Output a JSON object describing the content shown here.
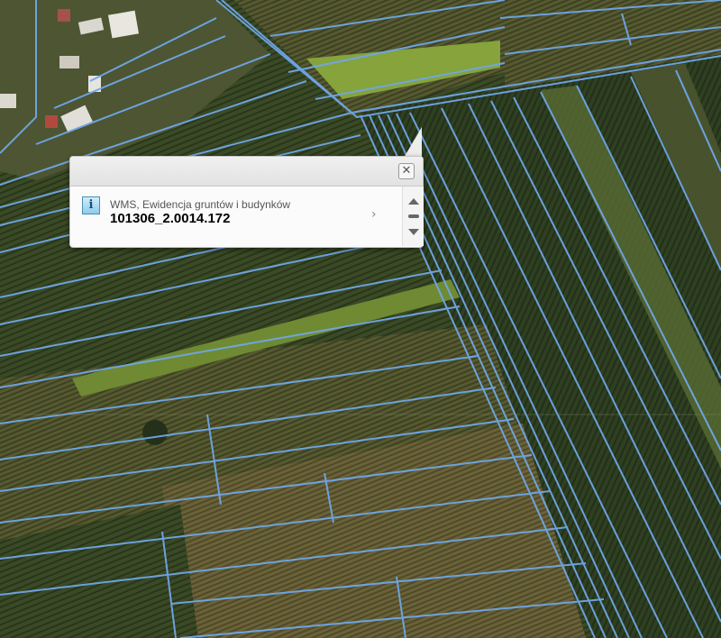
{
  "map": {
    "colors": {
      "parcel_line": "#6fa7e8",
      "road_line": "#7fb0e4",
      "field_dark": "#2e3c1f",
      "field_mid": "#4c5a2e",
      "field_light": "#6e6a3b",
      "field_green": "#6f8a33",
      "field_bright": "#8eaa3b"
    }
  },
  "popup": {
    "close_label": "✕",
    "info_icon": "i",
    "layer_name": "WMS, Ewidencja gruntów i budynków",
    "feature_id": "101306_2.0014.172",
    "details_icon": "chevron-right-icon",
    "details_glyph": "›"
  }
}
